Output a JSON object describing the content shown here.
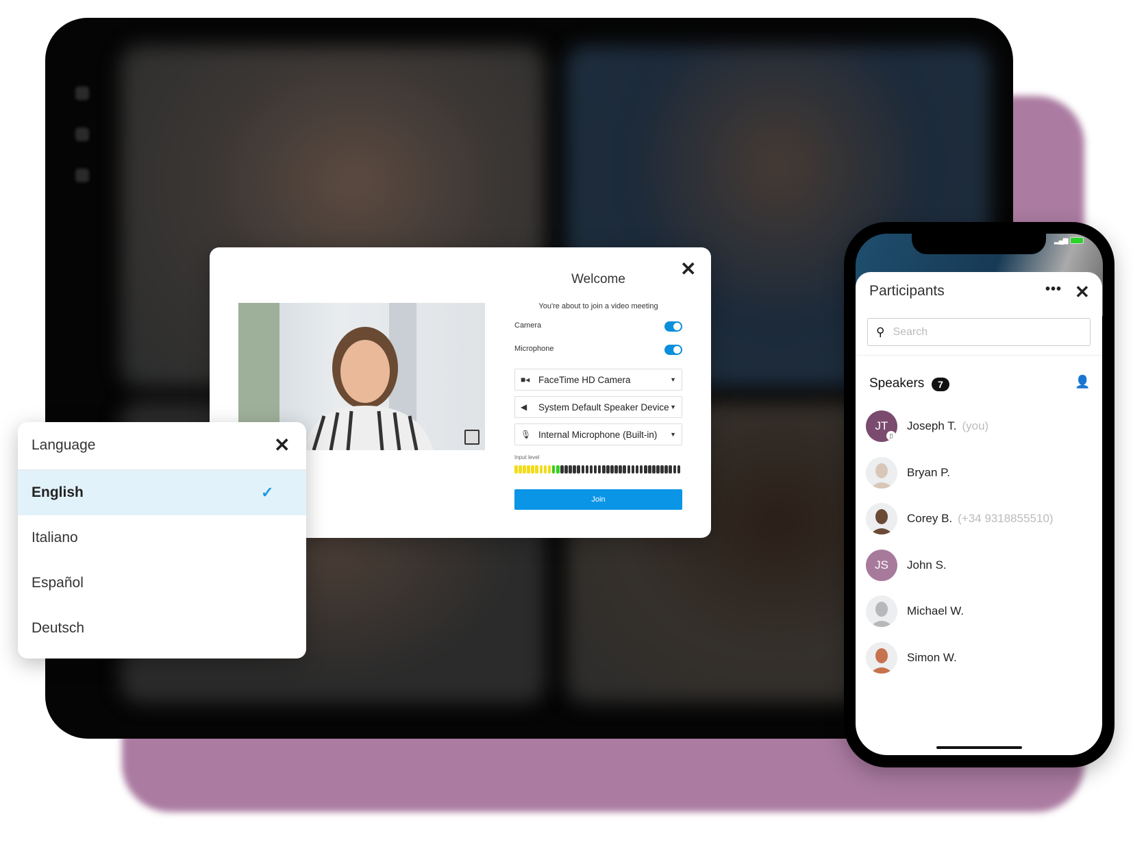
{
  "welcome": {
    "title": "Welcome",
    "subtitle": "You're about to join a video meeting",
    "camera_label": "Camera",
    "camera_on": true,
    "microphone_label": "Microphone",
    "microphone_on": true,
    "camera_device": "FaceTime HD Camera",
    "speaker_device": "System Default Speaker Device",
    "microphone_device": "Internal Microphone (Built-in)",
    "input_level_label": "Input level",
    "input_level": 0.27,
    "join_label": "Join",
    "colors": {
      "accent": "#0a95e6",
      "level_low": "#f2dc1a",
      "level_mid": "#33d11f",
      "level_off": "#333333"
    }
  },
  "language": {
    "title": "Language",
    "options": [
      {
        "label": "English",
        "selected": true
      },
      {
        "label": "Italiano",
        "selected": false
      },
      {
        "label": "Español",
        "selected": false
      },
      {
        "label": "Deutsch",
        "selected": false
      }
    ]
  },
  "participants": {
    "title": "Participants",
    "search_placeholder": "Search",
    "section_label": "Speakers",
    "count": "7",
    "list": [
      {
        "initials": "JT",
        "name": "Joseph T.",
        "extra": "(you)",
        "color": "#7a4b6e"
      },
      {
        "initials": "",
        "name": "Bryan P.",
        "extra": "",
        "color": "#d8c7b8"
      },
      {
        "initials": "",
        "name": "Corey B.",
        "extra": "(+34 9318855510)",
        "color": "#6b4a35"
      },
      {
        "initials": "JS",
        "name": "John S.",
        "extra": "",
        "color": "#a77a9c"
      },
      {
        "initials": "",
        "name": "Michael W.",
        "extra": "",
        "color": "#b8b8bc"
      },
      {
        "initials": "",
        "name": "Simon W.",
        "extra": "",
        "color": "#c7724e"
      }
    ]
  }
}
